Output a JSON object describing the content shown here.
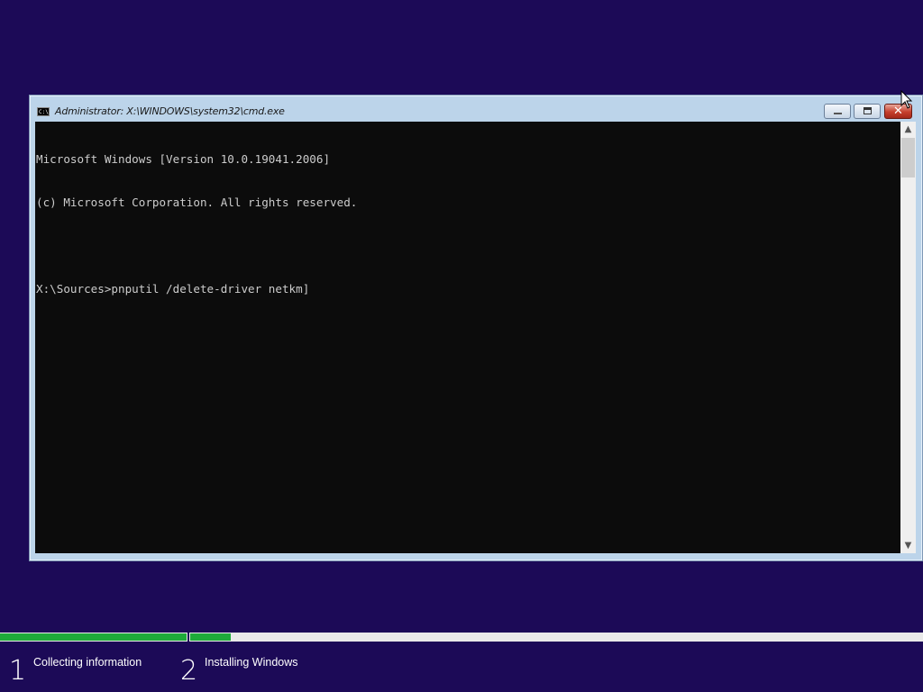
{
  "window": {
    "title": "Administrator: X:\\WINDOWS\\system32\\cmd.exe",
    "icon_text": "C:\\",
    "close_glyph": "✕"
  },
  "console": {
    "lines": [
      "Microsoft Windows [Version 10.0.19041.2006]",
      "(c) Microsoft Corporation. All rights reserved.",
      "",
      "X:\\Sources>pnputil /delete-driver netkm]"
    ]
  },
  "scrollbar": {
    "up_glyph": "▲",
    "down_glyph": "▼"
  },
  "steps": [
    {
      "number": "1",
      "label": "Collecting information"
    },
    {
      "number": "2",
      "label": "Installing Windows"
    }
  ],
  "progress": {
    "step1_fraction": 1.0,
    "step2_fraction": 0.05
  },
  "colors": {
    "desktop_bg": "#1c0a57",
    "progress_fill": "#1eaa3a",
    "console_bg": "#0c0c0c",
    "console_text": "#cccccc"
  }
}
